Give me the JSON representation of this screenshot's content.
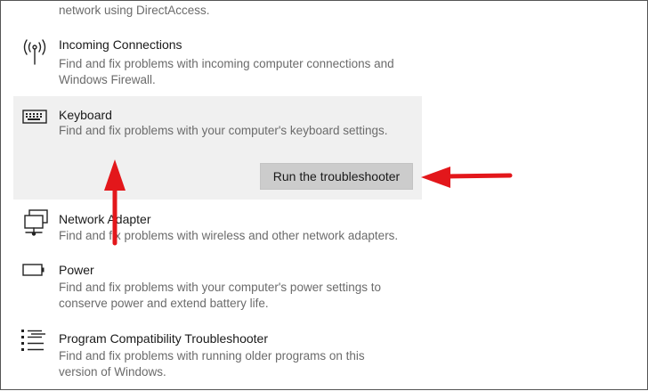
{
  "partial_top": {
    "description_tail": "network using DirectAccess."
  },
  "items": [
    {
      "icon": "antenna-icon",
      "title": "Incoming Connections",
      "desc_lines": [
        "Find and fix problems with incoming computer connections and",
        "Windows Firewall."
      ]
    },
    {
      "icon": "keyboard-icon",
      "title": "Keyboard",
      "desc_lines": [
        "Find and fix problems with your computer's keyboard settings."
      ],
      "selected": true,
      "button_label": "Run the troubleshooter"
    },
    {
      "icon": "network-adapter-icon",
      "title": "Network Adapter",
      "desc_lines": [
        "Find and fix problems with wireless and other network adapters."
      ]
    },
    {
      "icon": "battery-icon",
      "title": "Power",
      "desc_lines": [
        "Find and fix problems with your computer's power settings to",
        "conserve power and extend battery life."
      ]
    },
    {
      "icon": "program-list-icon",
      "title": "Program Compatibility Troubleshooter",
      "desc_lines": [
        "Find and fix problems with running older programs on this",
        "version of Windows."
      ]
    }
  ],
  "colors": {
    "annotation_arrow": "#e3171b",
    "selected_background": "#f0f0f0",
    "button_background": "#cccccc"
  }
}
